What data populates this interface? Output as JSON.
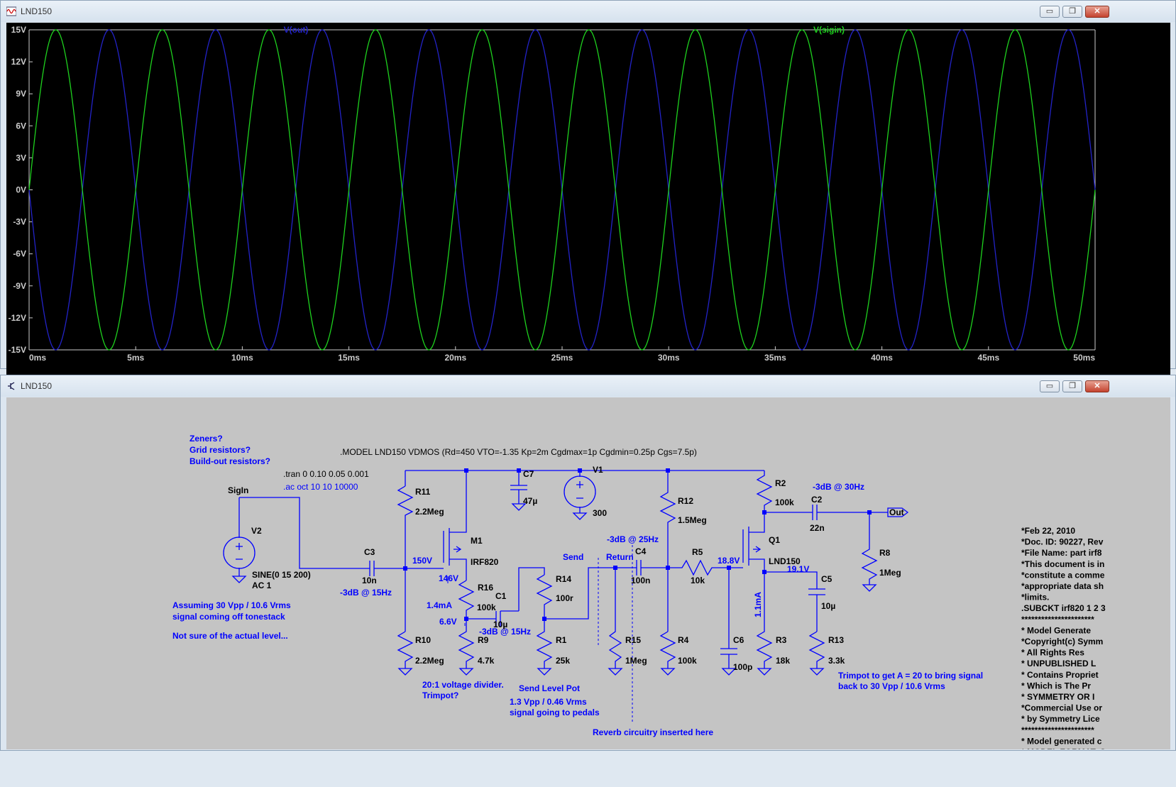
{
  "plot_window": {
    "title": "LND150",
    "controls": {
      "minimize": "▭",
      "restore": "❐",
      "close": "✕"
    }
  },
  "schematic_window": {
    "title": "LND150",
    "controls": {
      "minimize": "▭",
      "restore": "❐",
      "close": "✕"
    }
  },
  "colors": {
    "vout": "#2323c8",
    "vsigin": "#1ed21e",
    "wire": "#0000ff",
    "label": "#0000ff",
    "plot_bg": "#000000",
    "schematic_bg": "#c4c4c4"
  },
  "chart_data": {
    "type": "line",
    "x_ticks": [
      "0ms",
      "5ms",
      "10ms",
      "15ms",
      "20ms",
      "25ms",
      "30ms",
      "35ms",
      "40ms",
      "45ms",
      "50ms"
    ],
    "y_ticks": [
      "15V",
      "12V",
      "9V",
      "6V",
      "3V",
      "0V",
      "-3V",
      "-6V",
      "-9V",
      "-12V",
      "-15V"
    ],
    "xlim": [
      0,
      50
    ],
    "ylim": [
      -15,
      15
    ],
    "x_unit": "ms",
    "grid": false,
    "series": [
      {
        "name": "V(out)",
        "color": "#2323c8",
        "amplitude": 15,
        "frequency_hz": 200,
        "phase": "inverted"
      },
      {
        "name": "V(sigin)",
        "color": "#1ed21e",
        "amplitude": 15,
        "frequency_hz": 200,
        "phase": "normal"
      }
    ]
  },
  "schematic": {
    "notes": {
      "zeners": "Zeners?",
      "grid": "Grid resistors?",
      "buildout": "Build-out resistors?",
      "model": ".MODEL LND150 VDMOS (Rd=450 VTO=-1.35 Kp=2m Cgdmax=1p Cgdmin=0.25p Cgs=7.5p)",
      "tran": ".tran 0 0.10 0.05 0.001",
      "ac": ".ac oct 10 10 10000",
      "assume1": "Assuming 30 Vpp / 10.6 Vrms",
      "assume2": "signal coming off tonestack",
      "notsure": "Not sure of the actual level...",
      "divider1": "20:1 voltage divider.",
      "divider2": "Trimpot?",
      "sendpot": "Send Level Pot",
      "sendsig1": "1.3 Vpp / 0.46 Vrms",
      "sendsig2": "signal going to pedals",
      "reverb": "Reverb circuitry inserted here",
      "trim1": "Trimpot to get A = 20 to bring signal",
      "trim2": "back to 30 Vpp / 10.6 Vrms",
      "c3_3db": "-3dB @ 15Hz",
      "c1_3db": "-3dB @ 15Hz",
      "c4_3db": "-3dB @ 25Hz",
      "c2_3db": "-3dB @ 30Hz"
    },
    "labels": {
      "sigin": "SigIn",
      "v2": "V2",
      "v2_val": "SINE(0 15 200)",
      "v2_ac": "AC 1",
      "c3": "C3",
      "c3_val": "10n",
      "r11": "R11",
      "r11_val": "2.2Meg",
      "r10": "R10",
      "r10_val": "2.2Meg",
      "m1": "M1",
      "m1_val": "IRF820",
      "r16": "R16",
      "r16_val": "100k",
      "r9": "R9",
      "r9_val": "4.7k",
      "c1": "C1",
      "c1_val": "10µ",
      "c7": "C7",
      "c7_val": "47µ",
      "v1": "V1",
      "v1_val": "300",
      "r14": "R14",
      "r14_val": "100r",
      "r1": "R1",
      "r1_val": "25k",
      "send": "Send",
      "return": "Return",
      "c4": "C4",
      "c4_val": "100n",
      "r15": "R15",
      "r15_val": "1Meg",
      "r12": "R12",
      "r12_val": "1.5Meg",
      "r4": "R4",
      "r4_val": "100k",
      "r5": "R5",
      "r5_val": "10k",
      "c6": "C6",
      "c6_val": "100p",
      "r2": "R2",
      "r2_val": "100k",
      "q1": "Q1",
      "q1_val": "LND150",
      "r3": "R3",
      "r3_val": "18k",
      "c5": "C5",
      "c5_val": "10µ",
      "r13": "R13",
      "r13_val": "3.3k",
      "c2": "C2",
      "c2_val": "22n",
      "r8": "R8",
      "r8_val": "1Meg",
      "out": "Out"
    },
    "node_values": {
      "v150": "150V",
      "v146": "146V",
      "i14": "1.4mA",
      "v66": "6.6V",
      "v188": "18.8V",
      "v191": "19.1V",
      "i11": "1.1mA"
    },
    "netlist_text": [
      "*Feb 22, 2010",
      "*Doc. ID: 90227, Rev",
      "*File Name: part irf8",
      "*This document is in",
      "*constitute a comme",
      "*appropriate data sh",
      "*limits.",
      ".SUBCKT irf820 1 2 3",
      "**********************",
      "*    Model Generate",
      "*Copyright(c) Symm",
      "*       All Rights Res",
      "*   UNPUBLISHED L",
      "*   Contains Propriet",
      "*     Which is The Pr",
      "*     SYMMETRY OR I",
      "*Commercial Use or",
      "*   by Symmetry Lice",
      "**********************",
      "* Model generated c",
      "* MODEL FORMAT: S"
    ]
  }
}
